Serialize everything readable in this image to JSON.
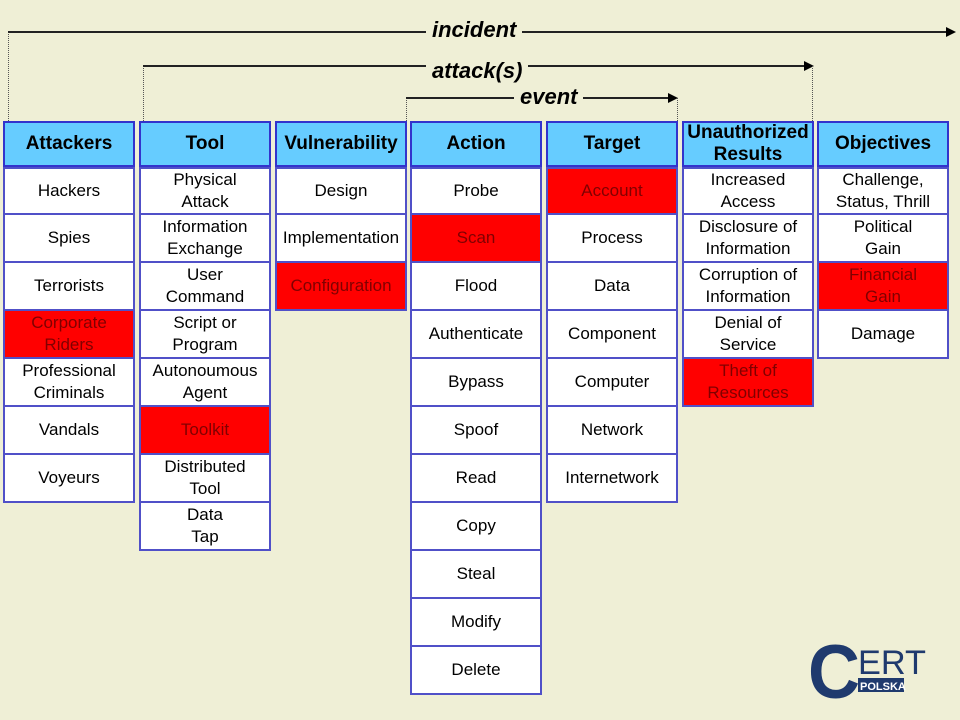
{
  "scopes": {
    "incident": "incident",
    "attacks": "attack(s)",
    "event": "event"
  },
  "colors": {
    "header": "#66ccff",
    "highlight": "#ff0000",
    "highlight_text": "#800000",
    "border": "#3333cc",
    "background": "#efefd6"
  },
  "columns": [
    {
      "header": "Attackers",
      "items": [
        {
          "t": "Hackers"
        },
        {
          "t": "Spies"
        },
        {
          "t": "Terrorists"
        },
        {
          "t": "Corporate\nRiders",
          "red": true
        },
        {
          "t": "Professional\nCriminals"
        },
        {
          "t": "Vandals"
        },
        {
          "t": "Voyeurs"
        }
      ]
    },
    {
      "header": "Tool",
      "items": [
        {
          "t": "Physical\nAttack"
        },
        {
          "t": "Information\nExchange"
        },
        {
          "t": "User\nCommand"
        },
        {
          "t": "Script or\nProgram"
        },
        {
          "t": "Autonoumous\nAgent"
        },
        {
          "t": "Toolkit",
          "red": true
        },
        {
          "t": "Distributed\nTool"
        },
        {
          "t": "Data\nTap"
        }
      ]
    },
    {
      "header": "Vulnerability",
      "items": [
        {
          "t": "Design"
        },
        {
          "t": "Implementation"
        },
        {
          "t": "Configuration",
          "red": true
        }
      ]
    },
    {
      "header": "Action",
      "items": [
        {
          "t": "Probe"
        },
        {
          "t": "Scan",
          "red": true
        },
        {
          "t": "Flood"
        },
        {
          "t": "Authenticate"
        },
        {
          "t": "Bypass"
        },
        {
          "t": "Spoof"
        },
        {
          "t": "Read"
        },
        {
          "t": "Copy"
        },
        {
          "t": "Steal"
        },
        {
          "t": "Modify"
        },
        {
          "t": "Delete"
        }
      ]
    },
    {
      "header": "Target",
      "items": [
        {
          "t": "Account",
          "red": true
        },
        {
          "t": "Process"
        },
        {
          "t": "Data"
        },
        {
          "t": "Component"
        },
        {
          "t": "Computer"
        },
        {
          "t": "Network"
        },
        {
          "t": "Internetwork"
        }
      ]
    },
    {
      "header": "Unauthorized\nResults",
      "items": [
        {
          "t": "Increased\nAccess"
        },
        {
          "t": "Disclosure of\nInformation"
        },
        {
          "t": "Corruption of\nInformation"
        },
        {
          "t": "Denial of\nService"
        },
        {
          "t": "Theft of\nResources",
          "red": true
        }
      ]
    },
    {
      "header": "Objectives",
      "items": [
        {
          "t": "Challenge,\nStatus, Thrill"
        },
        {
          "t": "Political\nGain"
        },
        {
          "t": "Financial\nGain",
          "red": true
        },
        {
          "t": "Damage"
        }
      ]
    }
  ],
  "logo": {
    "text": "CERT",
    "sub": "POLSKA"
  }
}
